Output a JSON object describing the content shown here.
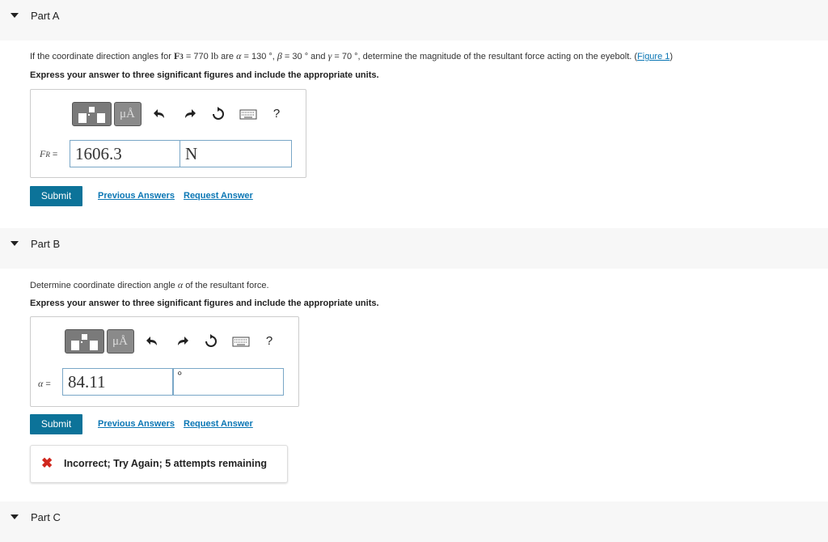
{
  "partA": {
    "title": "Part A",
    "question": {
      "t1": "If the coordinate direction angles for ",
      "f3": "F",
      "f3sub": "3",
      "t2": " = 770 ",
      "unit": "lb",
      "t3": " are ",
      "alpha": "α",
      "t4": " = 130 °, ",
      "beta": "β",
      "t5": " = 30 ° and ",
      "gamma": "γ",
      "t6": " = 70 °, determine the magnitude of the resultant force acting on the eyebolt. (",
      "link": "Figure 1",
      "t7": ")"
    },
    "instruction": "Express your answer to three significant figures and include the appropriate units.",
    "var_label": "F",
    "var_sub": "R",
    "var_eq": " =",
    "value": "1606.3",
    "unit": "N",
    "submit": "Submit",
    "prev": "Previous Answers",
    "request": "Request Answer"
  },
  "partB": {
    "title": "Part B",
    "question": {
      "t1": "Determine coordinate direction angle ",
      "alpha": "α",
      "t2": " of the resultant force."
    },
    "instruction": "Express your answer to three significant figures and include the appropriate units.",
    "var_label": "α",
    "var_eq": " =",
    "value": "84.11",
    "unit": "°",
    "submit": "Submit",
    "prev": "Previous Answers",
    "request": "Request Answer",
    "feedback": "Incorrect; Try Again; 5 attempts remaining"
  },
  "partC": {
    "title": "Part C"
  },
  "toolbar": {
    "units_label": "μÅ",
    "help_label": "?"
  },
  "colors": {
    "submit": "#0c7399",
    "link": "#0a76b4",
    "error": "#d0271d"
  }
}
